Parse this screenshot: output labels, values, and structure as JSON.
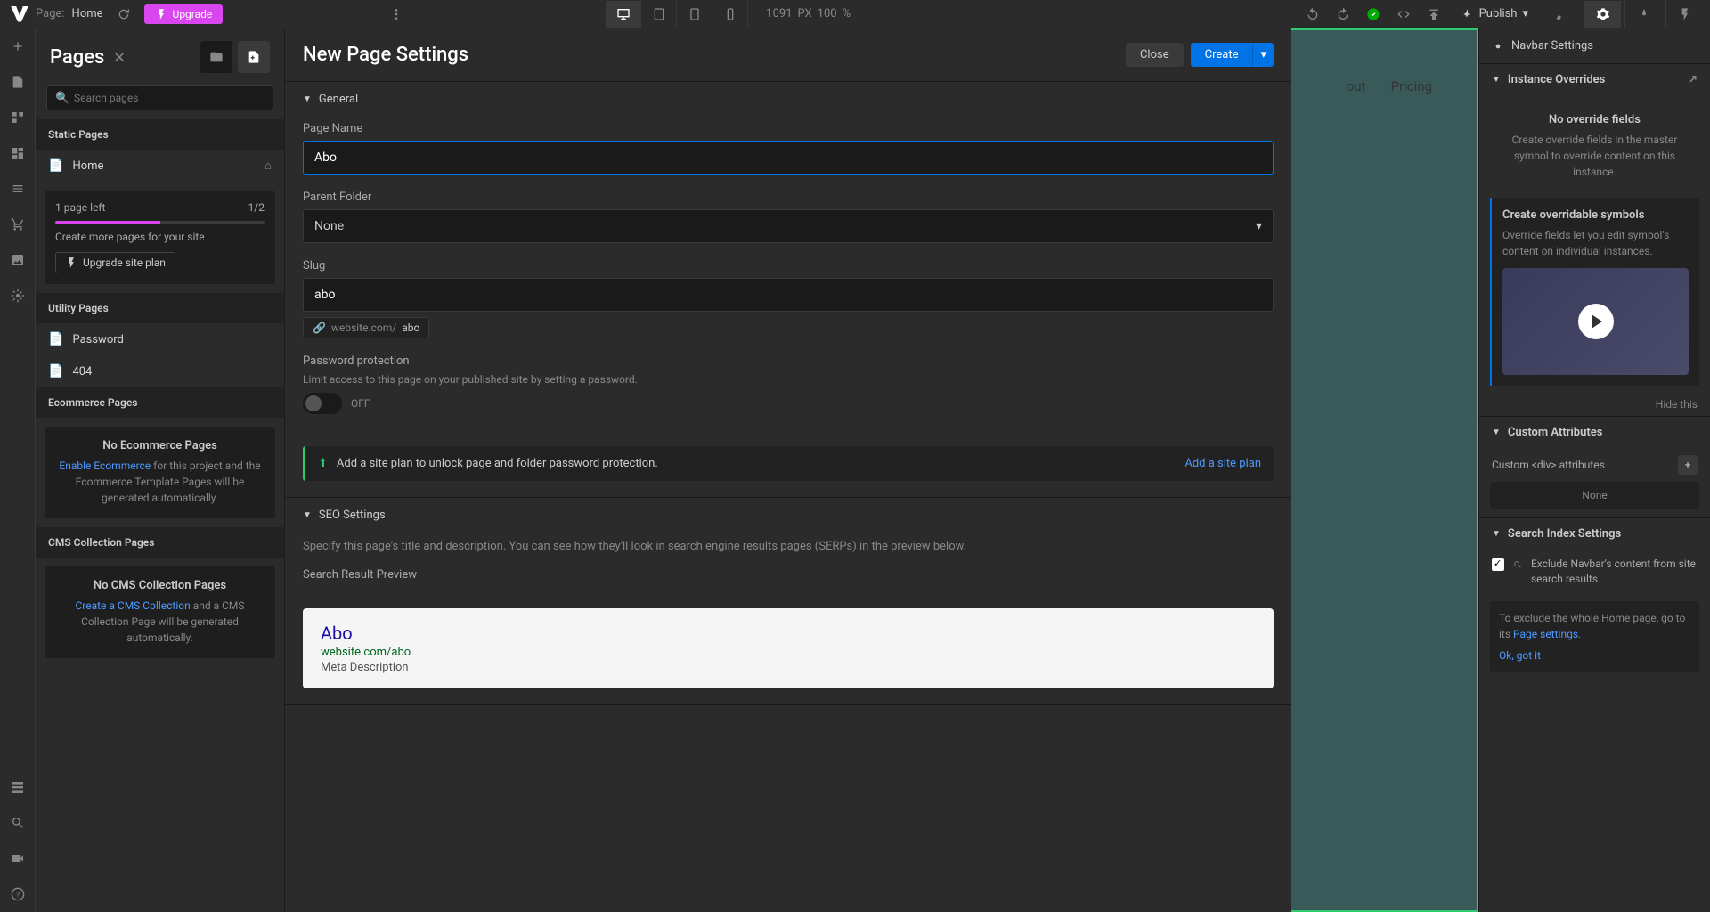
{
  "topbar": {
    "page_prefix": "Page:",
    "page_name": "Home",
    "upgrade_label": "Upgrade",
    "viewport_width": "1091",
    "viewport_unit": "PX",
    "zoom_value": "100",
    "zoom_unit": "%",
    "publish_label": "Publish"
  },
  "pages_panel": {
    "title": "Pages",
    "search_placeholder": "Search pages",
    "static_header": "Static Pages",
    "home_label": "Home",
    "quota": {
      "left_label": "1 page left",
      "count": "1/2",
      "more_text": "Create more pages for your site",
      "upgrade_label": "Upgrade site plan"
    },
    "utility_header": "Utility Pages",
    "password_label": "Password",
    "notfound_label": "404",
    "ecommerce_header": "Ecommerce Pages",
    "ecommerce_empty": {
      "title": "No Ecommerce Pages",
      "link": "Enable Ecommerce",
      "desc": " for this project and the Ecommerce Template Pages will be generated automatically."
    },
    "cms_header": "CMS Collection Pages",
    "cms_empty": {
      "title": "No CMS Collection Pages",
      "link": "Create a CMS Collection",
      "desc": " and a CMS Collection Page will be generated automatically."
    }
  },
  "settings": {
    "title": "New Page Settings",
    "close_label": "Close",
    "create_label": "Create",
    "general_header": "General",
    "page_name_label": "Page Name",
    "page_name_value": "Abo",
    "parent_label": "Parent Folder",
    "parent_value": "None",
    "slug_label": "Slug",
    "slug_value": "abo",
    "slug_domain": "website.com/",
    "slug_path": "abo",
    "pw_header": "Password protection",
    "pw_desc": "Limit access to this page on your published site by setting a password.",
    "pw_toggle": "OFF",
    "unlock_text": "Add a site plan to unlock page and folder password protection.",
    "unlock_link": "Add a site plan",
    "seo_header": "SEO Settings",
    "seo_desc": "Specify this page's title and description. You can see how they'll look in search engine results pages (SERPs) in the preview below.",
    "serp_label": "Search Result Preview",
    "serp": {
      "title": "Abo",
      "url": "website.com/abo",
      "meta": "Meta Description"
    }
  },
  "canvas": {
    "nav_about": "out",
    "nav_pricing": "Pricing"
  },
  "right": {
    "navbar_label": "Navbar Settings",
    "overrides_header": "Instance Overrides",
    "no_override_title": "No override fields",
    "no_override_desc": "Create override fields in the master symbol to override content on this instance.",
    "callout_title": "Create overridable symbols",
    "callout_desc": "Override fields let you edit symbol's content on individual instances.",
    "hide_label": "Hide this",
    "custom_attr_header": "Custom Attributes",
    "custom_attr_label": "Custom <div> attributes",
    "none_label": "None",
    "search_idx_header": "Search Index Settings",
    "exclude_text": "Exclude Navbar's content from site search results",
    "help_text1": "To exclude the whole Home page, go to its ",
    "help_link": "Page settings",
    "help_text2": ".",
    "ok_label": "Ok, got it"
  }
}
